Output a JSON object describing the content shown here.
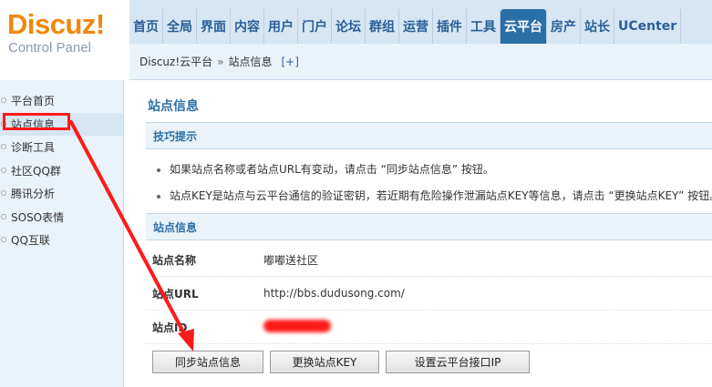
{
  "logo": {
    "main": "Discuz!",
    "sub": "Control Panel"
  },
  "nav": [
    "首页",
    "全局",
    "界面",
    "内容",
    "用户",
    "门户",
    "论坛",
    "群组",
    "运营",
    "插件",
    "工具",
    "云平台",
    "房产",
    "站长",
    "UCenter"
  ],
  "nav_active_index": 11,
  "breadcrumb": {
    "root": "Discuz!云平台",
    "separator": "»",
    "current": "站点信息",
    "add": "[+]"
  },
  "sidebar": {
    "items": [
      {
        "label": "平台首页"
      },
      {
        "label": "站点信息"
      },
      {
        "label": "诊断工具"
      },
      {
        "label": "社区QQ群"
      },
      {
        "label": "腾讯分析"
      },
      {
        "label": "SOSO表情"
      },
      {
        "label": "QQ互联"
      }
    ],
    "active_index": 1
  },
  "main": {
    "title": "站点信息",
    "tips_heading": "技巧提示",
    "tips": [
      "如果站点名称或者站点URL有变动，请点击 “同步站点信息” 按钮。",
      "站点KEY是站点与云平台通信的验证密钥，若近期有危险操作泄漏站点KEY等信息，请点击 “更换站点KEY” 按钮。"
    ],
    "info_heading": "站点信息",
    "fields": [
      {
        "label": "站点名称",
        "value": "嘟嘟送社区"
      },
      {
        "label": "站点URL",
        "value": "http://bbs.dudusong.com/"
      },
      {
        "label": "站点ID",
        "value": ""
      }
    ],
    "buttons": {
      "sync": "同步站点信息",
      "change_key": "更换站点KEY",
      "set_ip": "设置云平台接口IP"
    }
  },
  "colors": {
    "brand_orange": "#f0880f",
    "nav_blue": "#2b5f97",
    "active_tab": "#2b6fa8",
    "annotation_red": "#ff1a1a"
  }
}
